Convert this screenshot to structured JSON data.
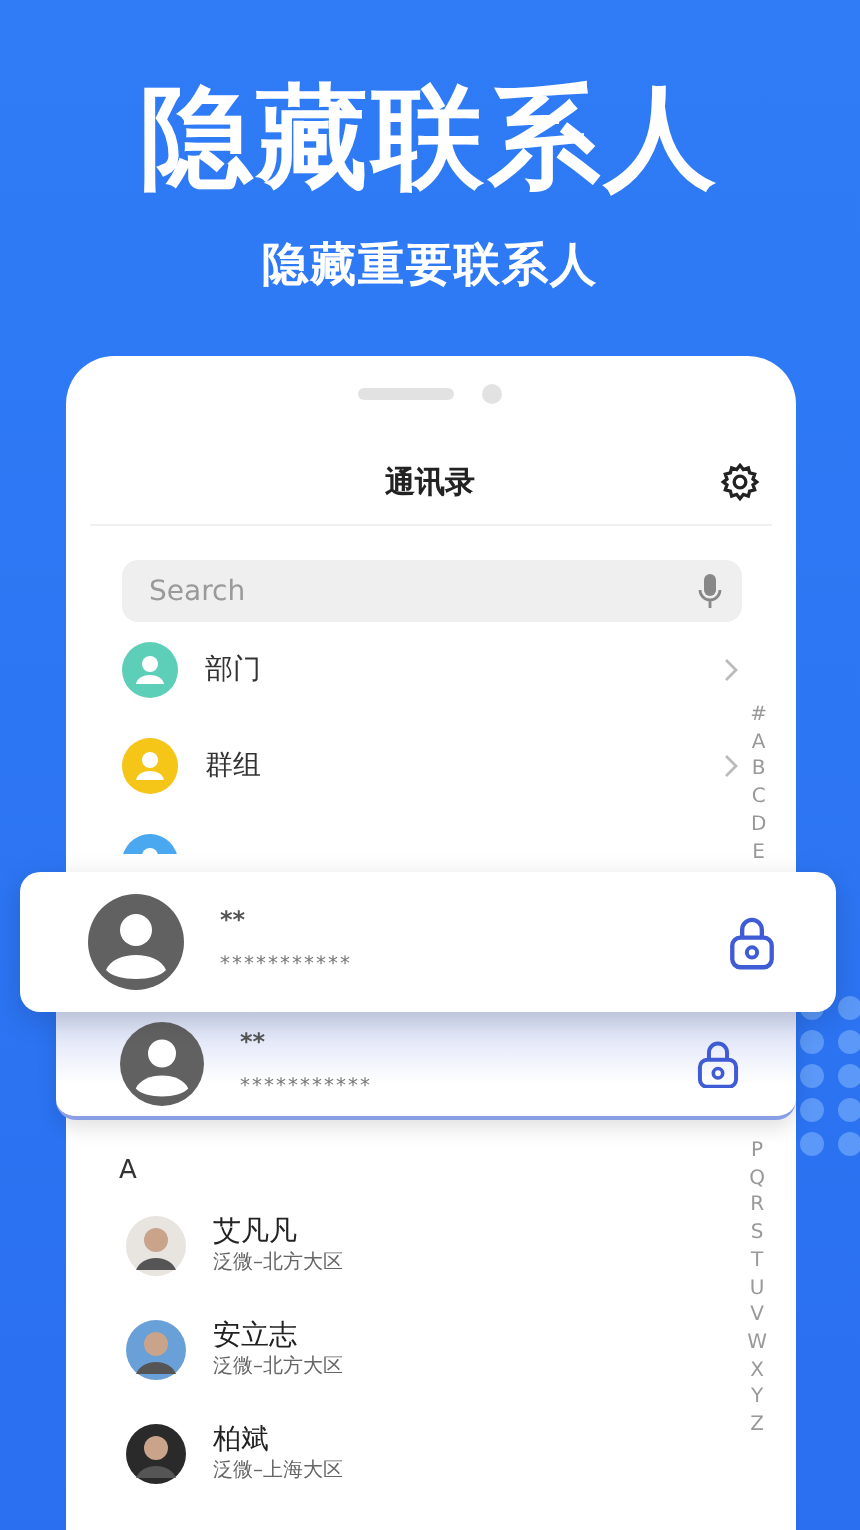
{
  "headline": "隐藏联系人",
  "subheadline": "隐藏重要联系人",
  "app": {
    "title": "通讯录",
    "search": {
      "placeholder": "Search"
    },
    "menu": [
      {
        "label": "部门",
        "color": "#5dcfb8"
      },
      {
        "label": "群组",
        "color": "#f5c518"
      },
      {
        "color": "#4aa8f0"
      }
    ],
    "section": "A",
    "contacts": [
      {
        "name": "艾凡凡",
        "org": "泛微–北方大区"
      },
      {
        "name": "安立志",
        "org": "泛微–北方大区"
      },
      {
        "name": "柏斌",
        "org": "泛微–上海大区"
      }
    ],
    "index_top": [
      "#",
      "A",
      "B",
      "C",
      "D",
      "E"
    ],
    "index_bottom": [
      "P",
      "Q",
      "R",
      "S",
      "T",
      "U",
      "V",
      "W",
      "X",
      "Y",
      "Z"
    ]
  },
  "hidden_contacts": [
    {
      "name": "**",
      "number": "***********"
    },
    {
      "name": "**",
      "number": "***********"
    }
  ]
}
